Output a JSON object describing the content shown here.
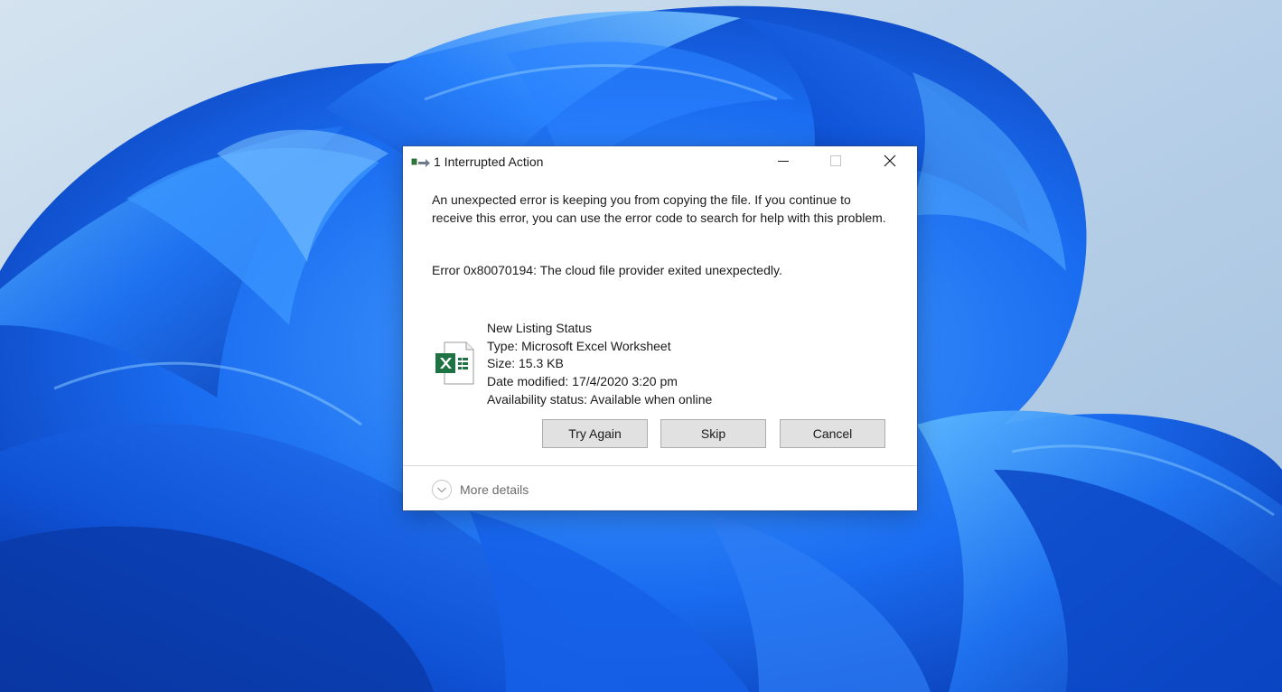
{
  "dialog": {
    "title": "1 Interrupted Action",
    "window_buttons": {
      "minimize": "minimize-icon",
      "maximize": "maximize-icon",
      "close": "close-icon"
    },
    "message": "An unexpected error is keeping you from copying the file. If you continue to receive this error, you can use the error code to search for help with this problem.",
    "error": "Error 0x80070194: The cloud file provider exited unexpectedly.",
    "file": {
      "icon": "excel-file-icon",
      "name": "New Listing Status",
      "type": "Type: Microsoft Excel Worksheet",
      "size": "Size: 15.3 KB",
      "date_modified": "Date modified: 17/4/2020 3:20 pm",
      "availability": "Availability status: Available when online"
    },
    "buttons": {
      "try_again": "Try Again",
      "skip": "Skip",
      "cancel": "Cancel"
    },
    "more_details": "More details"
  },
  "colors": {
    "wallpaper_blue": "#1a5fe0",
    "excel_green": "#1f7244",
    "button_face": "#e1e1e1",
    "button_border": "#adadad"
  }
}
